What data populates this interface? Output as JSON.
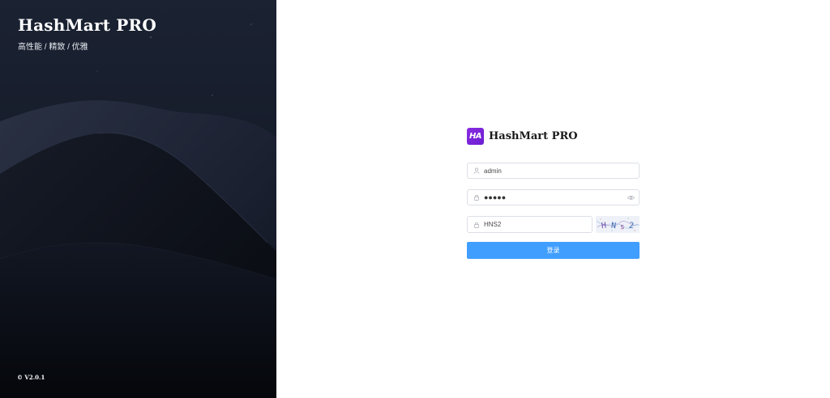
{
  "brand": {
    "title": "HashMart PRO",
    "subtitle": "高性能 / 精致 / 优雅",
    "version": "© V2.0.1"
  },
  "login": {
    "logo_mark": "HA",
    "logo_text": "HashMart PRO",
    "username": {
      "value": "admin",
      "icon": "user-icon"
    },
    "password": {
      "value": "●●●●●",
      "icon": "lock-icon",
      "toggle_icon": "eye-icon"
    },
    "captcha": {
      "value": "HNS2",
      "icon": "lock-icon",
      "image_text": "HNs2"
    },
    "submit_label": "登录"
  },
  "colors": {
    "left_bg": "#0e141f",
    "primary": "#409eff",
    "logo_purple": "#7b22d8",
    "border": "#dcdfe6"
  }
}
